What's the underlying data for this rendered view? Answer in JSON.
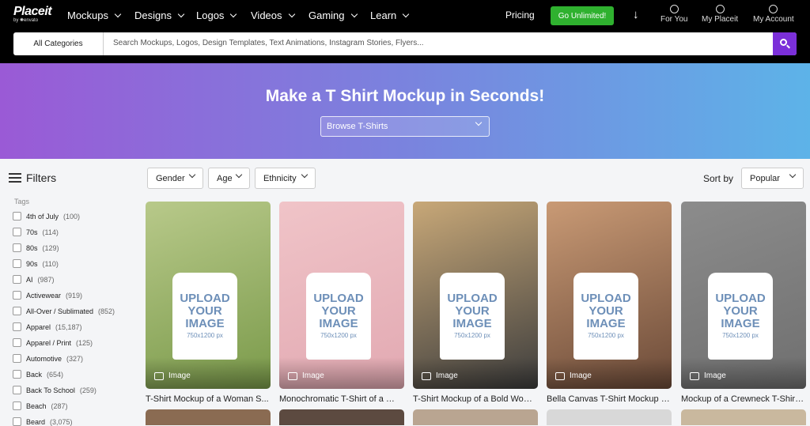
{
  "header": {
    "logo": "Placeit",
    "logo_sub": "by ✺envato",
    "nav": [
      {
        "label": "Mockups"
      },
      {
        "label": "Designs"
      },
      {
        "label": "Logos"
      },
      {
        "label": "Videos"
      },
      {
        "label": "Gaming"
      },
      {
        "label": "Learn"
      }
    ],
    "pricing": "Pricing",
    "cta": "Go Unlimited!",
    "account_links": [
      {
        "label": "For You",
        "icon": "compass-icon"
      },
      {
        "label": "My Placeit",
        "icon": "smiley-icon"
      },
      {
        "label": "My Account",
        "icon": "user-icon"
      }
    ]
  },
  "search": {
    "category": "All Categories",
    "placeholder": "Search Mockups, Logos, Design Templates, Text Animations, Instagram Stories, Flyers..."
  },
  "banner": {
    "title": "Make a T Shirt Mockup in Seconds!",
    "dropdown": "Browse T-Shirts",
    "colors": [
      "#9a5ad6",
      "#7a83de",
      "#5db3e8"
    ]
  },
  "filters": {
    "title": "Filters",
    "tags_label": "Tags",
    "tags": [
      {
        "label": "4th of July",
        "count": "(100)"
      },
      {
        "label": "70s",
        "count": "(114)"
      },
      {
        "label": "80s",
        "count": "(129)"
      },
      {
        "label": "90s",
        "count": "(110)"
      },
      {
        "label": "AI",
        "count": "(987)"
      },
      {
        "label": "Activewear",
        "count": "(919)"
      },
      {
        "label": "All-Over / Sublimated",
        "count": "(852)"
      },
      {
        "label": "Apparel",
        "count": "(15,187)"
      },
      {
        "label": "Apparel / Print",
        "count": "(125)"
      },
      {
        "label": "Automotive",
        "count": "(327)"
      },
      {
        "label": "Back",
        "count": "(654)"
      },
      {
        "label": "Back To School",
        "count": "(259)"
      },
      {
        "label": "Beach",
        "count": "(287)"
      },
      {
        "label": "Beard",
        "count": "(3,075)"
      }
    ]
  },
  "toolbar": {
    "filters": [
      "Gender",
      "Age",
      "Ethnicity"
    ],
    "sort_label": "Sort by",
    "sort_value": "Popular"
  },
  "results": [
    {
      "title": "T-Shirt Mockup of a Woman S...",
      "badge": "Image",
      "upload": "UPLOAD YOUR IMAGE",
      "dims": "750x1200 px",
      "colors": [
        "#b8c98a",
        "#7a9a4a"
      ]
    },
    {
      "title": "Monochromatic T-Shirt of a Wo...",
      "badge": "Image",
      "upload": "UPLOAD YOUR IMAGE",
      "dims": "750x1200 px",
      "colors": [
        "#f0c4c8",
        "#e2a9b2"
      ]
    },
    {
      "title": "T-Shirt Mockup of a Bold Wom...",
      "badge": "Image",
      "upload": "UPLOAD YOUR IMAGE",
      "dims": "750x1200 px",
      "colors": [
        "#c8a878",
        "#3d3d3d"
      ]
    },
    {
      "title": "Bella Canvas T-Shirt Mockup of...",
      "badge": "Image",
      "upload": "UPLOAD YOUR IMAGE",
      "dims": "750x1200 px",
      "colors": [
        "#c99a75",
        "#6b4a38"
      ]
    },
    {
      "title": "Mockup of a Crewneck T-Shirt ...",
      "badge": "Image",
      "upload": "UPLOAD YOUR IMAGE",
      "dims": "750x1200 px",
      "colors": [
        "#8c8c8c",
        "#6f6f6f"
      ]
    }
  ],
  "second_row_colors": [
    "#8a6b52",
    "#5c4a40",
    "#b9a591",
    "#d8d8d8",
    "#c9b89e"
  ]
}
